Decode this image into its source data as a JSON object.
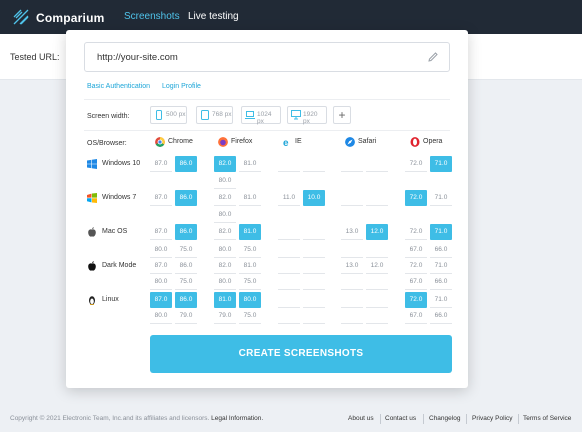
{
  "app": {
    "name": "Comparium"
  },
  "nav": {
    "screenshots": "Screenshots",
    "live_testing": "Live testing"
  },
  "tested_url_label": "Tested URL:",
  "url_input": {
    "value": "http://your-site.com"
  },
  "links": {
    "basic_auth": "Basic Authentication",
    "login_profile": "Login Profile"
  },
  "screen_width": {
    "label": "Screen width:",
    "options": [
      "500 px",
      "768 px",
      "1024 px",
      "1920 px"
    ]
  },
  "table": {
    "label": "OS/Browser:",
    "browsers": [
      "Chrome",
      "Firefox",
      "IE",
      "Safari",
      "Opera"
    ],
    "os": [
      "Windows 10",
      "Windows 7",
      "Mac OS",
      "Dark Mode",
      "Linux"
    ],
    "cells": [
      [
        "87.0",
        "86.0"
      ],
      [
        "82.0",
        "81.0"
      ],
      [
        "80.0"
      ],
      [
        "87.0",
        "86.0"
      ],
      [
        "82.0",
        "81.0"
      ],
      [
        "80.0"
      ],
      [
        "11.0",
        "10.0"
      ],
      [
        "87.0",
        "86.0"
      ],
      [
        "82.0",
        "81.0"
      ],
      [
        "80.0",
        "75.0"
      ],
      [
        "13.0",
        "12.0"
      ],
      [
        "87.0",
        "86.0"
      ],
      [
        "80.0",
        "75.0"
      ],
      [
        "82.0",
        "81.0"
      ],
      [
        "80.0",
        "75.0"
      ],
      [
        "13.0",
        "12.0"
      ],
      [
        "87.0",
        "86.0"
      ],
      [
        "80.0",
        "79.0"
      ],
      [
        "81.0",
        "80.0"
      ],
      [
        "79.0",
        "75.0"
      ],
      [
        "72.0",
        "71.0"
      ],
      [
        "72.0",
        "71.0"
      ],
      [
        "72.0",
        "71.0"
      ],
      [
        "67.0",
        "66.0"
      ],
      [
        "72.0",
        "71.0"
      ],
      [
        "67.0",
        "66.0"
      ],
      [
        "72.0",
        "71.0"
      ],
      [
        "67.0",
        "66.0"
      ]
    ]
  },
  "create_button": "CREATE SCREENSHOTS",
  "footer": {
    "copyright": "Copyright © 2021 Electronic Team, Inc.and its affiliates and licensors.",
    "legal": "Legal Information.",
    "links": [
      "About us",
      "Contact us",
      "Changelog",
      "Privacy Policy",
      "Terms of Service"
    ]
  },
  "colors": {
    "accent": "#3ebde6",
    "topbar": "#212a36"
  }
}
